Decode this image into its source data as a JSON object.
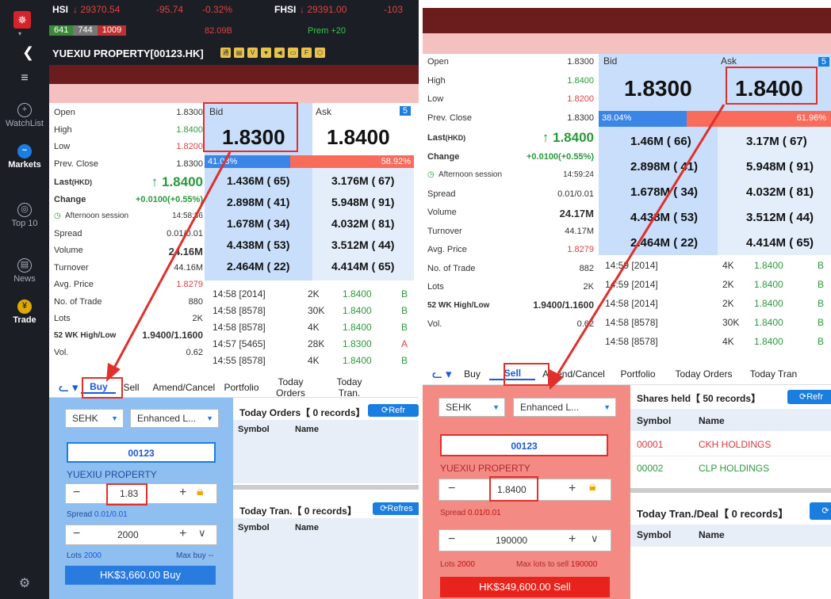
{
  "left": {
    "topbar": {
      "hsi_label": "HSI",
      "hsi_value": "↓ 29370.54",
      "hsi_change": "-95.74",
      "hsi_pct": "-0.32%",
      "fhsi_label": "FHSI",
      "fhsi_value": "↓ 29391.00",
      "fhsi_change": "-103",
      "counts": [
        "641",
        "744",
        "1009"
      ],
      "turnover": "82.09B",
      "prem": "Prem +20"
    },
    "title": "YUEXIU PROPERTY[00123.HK]",
    "sidebar": [
      {
        "label": "WatchList",
        "icon": "plus-circle-icon"
      },
      {
        "label": "Markets",
        "icon": "markets-icon"
      },
      {
        "label": "Top 10",
        "icon": "top10-icon"
      },
      {
        "label": "News",
        "icon": "news-icon"
      },
      {
        "label": "Trade",
        "icon": "trade-icon"
      }
    ],
    "quote": {
      "Open": "1.8300",
      "High": "1.8400",
      "Low": "1.8200",
      "Prev. Close": "1.8300",
      "last_label": "Last",
      "last_ccy": "(HKD)",
      "last": "↑ 1.8400",
      "change_label": "Change",
      "change": "+0.0100(+0.55%)",
      "session": "Afternoon session",
      "session_time": "14:58:36",
      "Spread": "0.01/0.01",
      "Volume": "24.16M",
      "Turnover": "44.16M",
      "Avg. Price": "1.8279",
      "No. of Trade": "880",
      "Lots": "2K",
      "52wk_label": "52 WK High/Low",
      "52wk": "1.9400/1.1600",
      "Vol.": "0.62"
    },
    "bid_label": "Bid",
    "ask_label": "Ask",
    "ask_badge": "5",
    "bid": "1.8300",
    "ask": "1.8400",
    "bid_pct": "41.08%",
    "ask_pct": "58.92%",
    "bid_depth": [
      [
        "1.436M (",
        "65)"
      ],
      [
        "2.898M (",
        "41)"
      ],
      [
        "1.678M (",
        "34)"
      ],
      [
        "4.438M (",
        "53)"
      ],
      [
        "2.464M (",
        "22)"
      ]
    ],
    "ask_depth": [
      [
        "3.176M (",
        "67)"
      ],
      [
        "5.948M (",
        "91)"
      ],
      [
        "4.032M (",
        "81)"
      ],
      [
        "3.512M (",
        "44)"
      ],
      [
        "4.414M (",
        "65)"
      ]
    ],
    "trades": [
      [
        "14:58 [2014]",
        "2K",
        "1.8400",
        "B"
      ],
      [
        "14:58 [8578]",
        "30K",
        "1.8400",
        "B"
      ],
      [
        "14:58 [8578]",
        "4K",
        "1.8400",
        "B"
      ],
      [
        "14:57 [5465]",
        "28K",
        "1.8300",
        "A"
      ],
      [
        "14:55 [8578]",
        "4K",
        "1.8400",
        "B"
      ]
    ],
    "tabs": [
      "Buy",
      "Sell",
      "Amend/Cancel",
      "Portfolio",
      "Today Orders",
      "Today Tran."
    ],
    "exchange": "SEHK",
    "order_type": "Enhanced L...",
    "code": "00123",
    "stock_name": "YUEXIU PROPERTY",
    "price": "1.83",
    "spread_label": "Spread",
    "spread_val": "0.01/0.01",
    "qty": "2000",
    "lots_label": "Lots",
    "lots_val": "2000",
    "maxbuy_label": "Max buy",
    "maxbuy_val": "--",
    "buy_btn": "HK$3,660.00  Buy",
    "orders_title": "Today Orders【 0 records】",
    "refresh": "⟳Refr",
    "refresh2": "⟳Refres",
    "tran_title": "Today Tran.【 0 records】",
    "col_symbol": "Symbol",
    "col_name": "Name"
  },
  "right": {
    "quote": {
      "Open": "1.8300",
      "High": "1.8400",
      "Low": "1.8200",
      "Prev. Close": "1.8300",
      "last": "↑ 1.8400",
      "change": "+0.0100(+0.55%)",
      "session_time": "14:59:24",
      "Spread": "0.01/0.01",
      "Volume": "24.17M",
      "Turnover": "44.17M",
      "Avg. Price": "1.8279",
      "No. of Trade": "882",
      "Lots": "2K",
      "52wk": "1.9400/1.1600",
      "Vol.": "0.62"
    },
    "bid": "1.8300",
    "ask": "1.8400",
    "bid_pct": "38.04%",
    "ask_pct": "61.96%",
    "bid_depth": [
      [
        "1.46M (",
        "66)"
      ],
      [
        "2.898M (",
        "41)"
      ],
      [
        "1.678M (",
        "34)"
      ],
      [
        "4.438M (",
        "53)"
      ],
      [
        "2.464M (",
        "22)"
      ]
    ],
    "ask_depth": [
      [
        "3.17M (",
        "67)"
      ],
      [
        "5.948M (",
        "91)"
      ],
      [
        "4.032M (",
        "81)"
      ],
      [
        "3.512M (",
        "44)"
      ],
      [
        "4.414M (",
        "65)"
      ]
    ],
    "trades": [
      [
        "14:59 [2014]",
        "4K",
        "1.8400",
        "B"
      ],
      [
        "14:59 [2014]",
        "2K",
        "1.8400",
        "B"
      ],
      [
        "14:58 [2014]",
        "2K",
        "1.8400",
        "B"
      ],
      [
        "14:58 [8578]",
        "30K",
        "1.8400",
        "B"
      ],
      [
        "14:58 [8578]",
        "4K",
        "1.8400",
        "B"
      ]
    ],
    "tabs": [
      "Buy",
      "Sell",
      "Amend/Cancel",
      "Portfolio",
      "Today Orders",
      "Today Tran"
    ],
    "exchange": "SEHK",
    "order_type": "Enhanced L...",
    "code": "00123",
    "stock_name": "YUEXIU PROPERTY",
    "price": "1.8400",
    "spread_val": "0.01/0.01",
    "qty": "190000",
    "lots_val": "2000",
    "maxsell_label": "Max lots to sell",
    "maxsell_val": "190000",
    "sell_btn": "HK$349,600.00   Sell",
    "shares_title": "Shares held【 50 records】",
    "refresh": "⟳Refr",
    "holdings": [
      [
        "00001",
        "CKH HOLDINGS"
      ],
      [
        "00002",
        "CLP HOLDINGS"
      ]
    ],
    "tran_title": "Today Tran./Deal【 0 records】"
  },
  "colors": {
    "dark": "#1b1f25",
    "bid_blue": "#c8defa",
    "ask_red": "#f96b5b",
    "highlight": "#e0302b",
    "sell_bg": "#f38a84",
    "buy_bg": "#8fbff0",
    "sell_btn": "#e8231c",
    "buy_btn": "#2a7be0"
  }
}
